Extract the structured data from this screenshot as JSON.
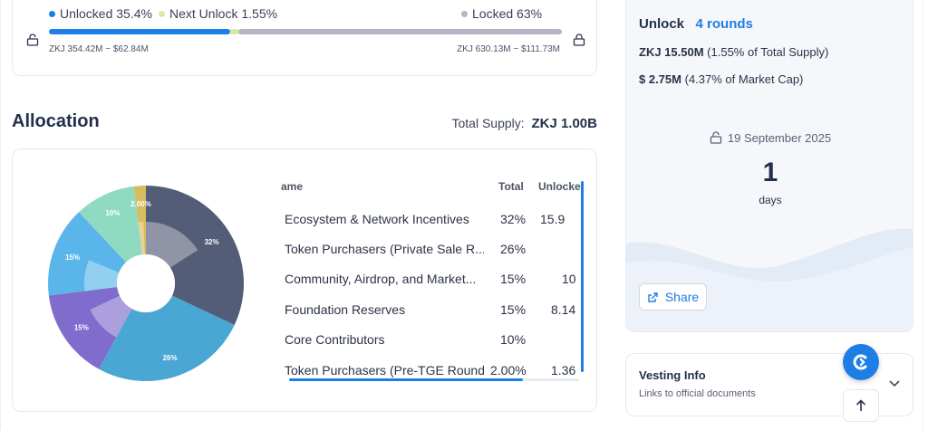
{
  "progress": {
    "unlocked_label": "Unlocked 35.4%",
    "next_unlock_label": "Next Unlock 1.55%",
    "locked_label": "Locked 63%",
    "unlocked_fraction": 0.354,
    "next_unlock_fraction": 0.0155,
    "locked_fraction": 0.63,
    "unlocked_value": "ZKJ 354.42M ~ $62.84M",
    "locked_value": "ZKJ 630.13M ~ $111.73M",
    "colors": {
      "unlocked": "#1d7fe6",
      "next": "#d8eaa0",
      "locked": "#b2b7c3"
    }
  },
  "allocation": {
    "title": "Allocation",
    "supply_label": "Total Supply:",
    "supply_value": "ZKJ 1.00B",
    "columns": {
      "name": "ame",
      "total": "Total",
      "unlocked": "Unlocke"
    },
    "rows": [
      {
        "name": "Ecosystem & Network Incentives",
        "total": "32%",
        "unlocked": "15.9"
      },
      {
        "name": "Token Purchasers (Private Sale R...",
        "total": "26%",
        "unlocked": ""
      },
      {
        "name": "Community, Airdrop, and Market...",
        "total": "15%",
        "unlocked": "10"
      },
      {
        "name": "Foundation Reserves",
        "total": "15%",
        "unlocked": "8.14"
      },
      {
        "name": "Core Contributors",
        "total": "10%",
        "unlocked": ""
      },
      {
        "name": "Token Purchasers (Pre-TGE Round)",
        "total": "2.00%",
        "unlocked": "1.36"
      }
    ]
  },
  "chart_data": {
    "type": "pie",
    "categories": [
      "Ecosystem & Network Incentives",
      "Token Purchasers (Private Sale Round)",
      "Community, Airdrop, and Marketing",
      "Foundation Reserves",
      "Core Contributors",
      "Token Purchasers (Pre-TGE Round)"
    ],
    "values": [
      32,
      26,
      15,
      15,
      10,
      2
    ],
    "labels": [
      "32%",
      "26%",
      "15%",
      "15%",
      "10%",
      "2.00%"
    ],
    "unlocked_values": [
      15.9,
      0,
      10,
      8.14,
      0,
      1.36
    ],
    "colors": [
      "#545d78",
      "#4aa6d2",
      "#7f6ccc",
      "#5ab6ea",
      "#8edbc2",
      "#d9bc60"
    ]
  },
  "unlock": {
    "title": "Unlock",
    "rounds": "4 rounds",
    "tokens_amount": "ZKJ 15.50M",
    "tokens_note": "(1.55% of Total Supply)",
    "usd_amount": "$ 2.75M",
    "usd_note": "(4.37% of Market Cap)",
    "date": "19 September 2025",
    "countdown_value": "1",
    "countdown_unit": "days",
    "share_label": "Share"
  },
  "vesting": {
    "title": "Vesting Info",
    "subtitle": "Links to official documents"
  }
}
